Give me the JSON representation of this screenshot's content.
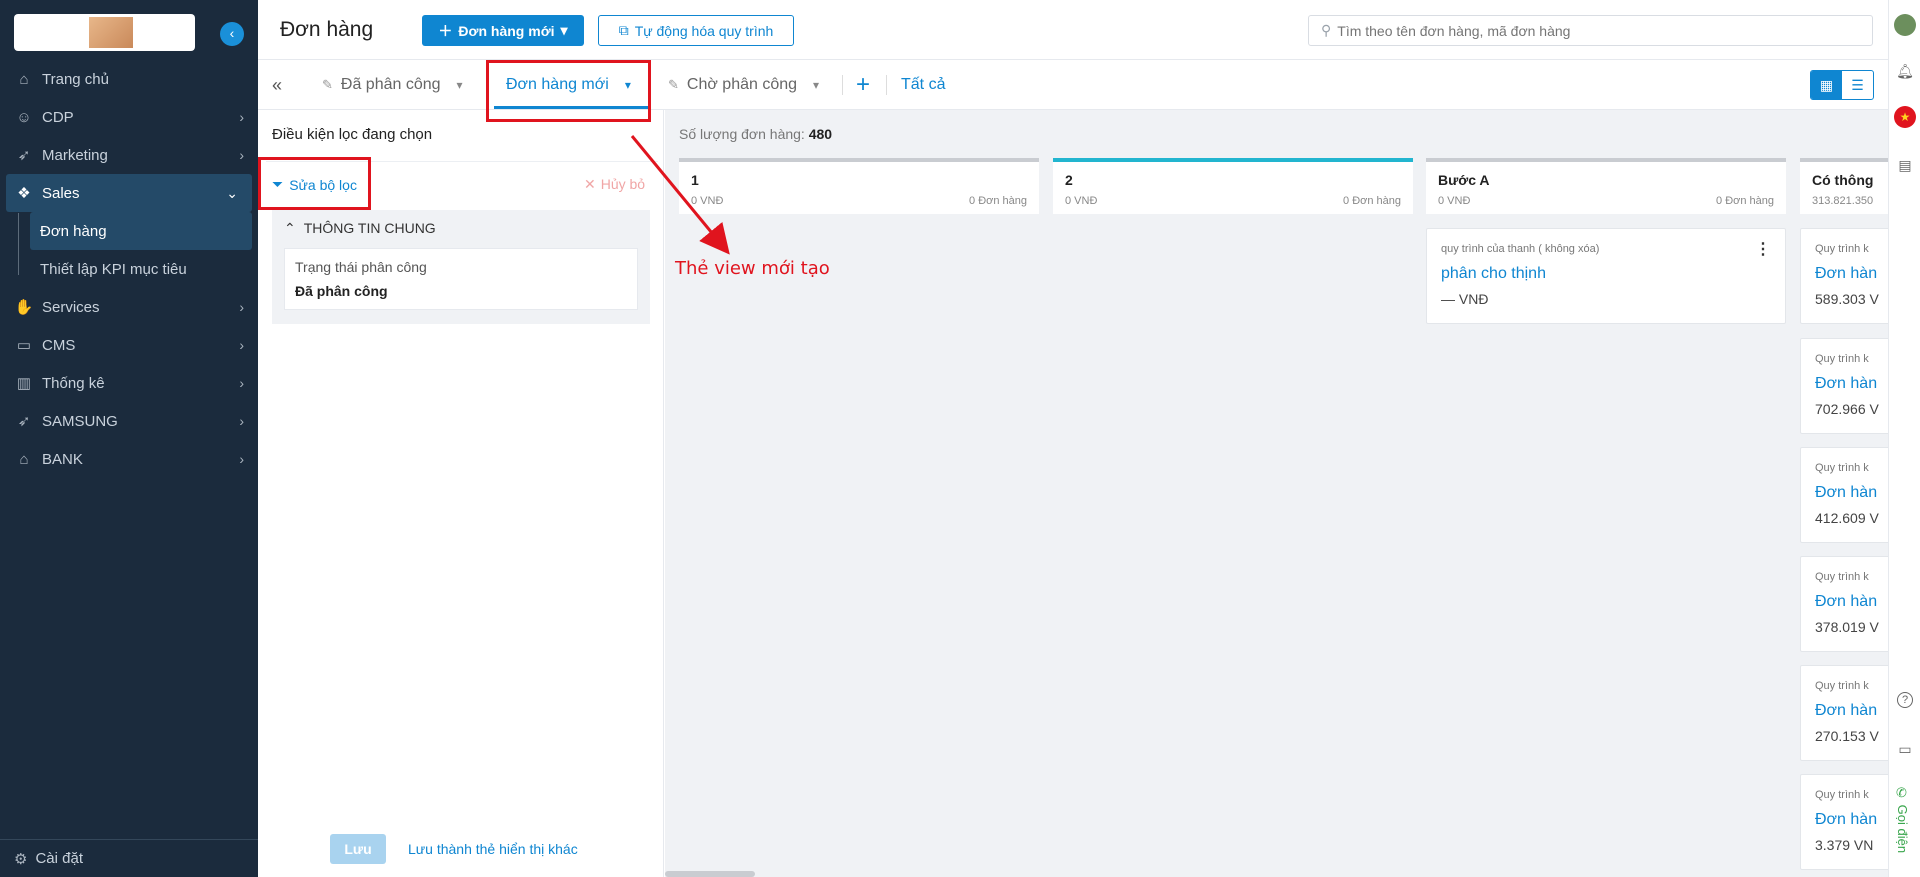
{
  "sidebar": {
    "items": [
      {
        "label": "Trang chủ",
        "icon": "home-icon"
      },
      {
        "label": "CDP",
        "icon": "user-icon"
      },
      {
        "label": "Marketing",
        "icon": "rocket-icon"
      },
      {
        "label": "Sales",
        "icon": "handshake-icon"
      },
      {
        "label": "Services",
        "icon": "hand-icon"
      },
      {
        "label": "CMS",
        "icon": "monitor-icon"
      },
      {
        "label": "Thống kê",
        "icon": "chart-icon"
      },
      {
        "label": "SAMSUNG",
        "icon": "rocket-icon"
      },
      {
        "label": "BANK",
        "icon": "bank-icon"
      }
    ],
    "sub_items": [
      {
        "label": "Đơn hàng"
      },
      {
        "label": "Thiết lập KPI mục tiêu"
      }
    ],
    "settings_label": "Cài đặt"
  },
  "header": {
    "title": "Đơn hàng",
    "new_order_label": "Đơn hàng mới",
    "automation_label": "Tự động hóa quy trình",
    "search_placeholder": "Tìm theo tên đơn hàng, mã đơn hàng"
  },
  "tabs": {
    "items": [
      {
        "label": "Đã phân công"
      },
      {
        "label": "Đơn hàng mới"
      },
      {
        "label": "Chờ phân công"
      }
    ],
    "all_label": "Tất cả"
  },
  "filter": {
    "title": "Điều kiện lọc đang chọn",
    "edit_label": "Sửa bộ lọc",
    "cancel_label": "Hủy bỏ",
    "section_title": "THÔNG TIN CHUNG",
    "field_label": "Trạng thái phân công",
    "field_value": "Đã phân công",
    "save_label": "Lưu",
    "save_as_label": "Lưu thành thẻ hiển thị khác"
  },
  "board": {
    "count_label": "Số lượng đơn hàng:",
    "count_value": "480",
    "columns": [
      {
        "title": "1",
        "amount": "0 VNĐ",
        "count": "0 Đơn hàng"
      },
      {
        "title": "2",
        "amount": "0 VNĐ",
        "count": "0 Đơn hàng"
      },
      {
        "title": "Bước A",
        "amount": "0 VNĐ",
        "count": "0 Đơn hàng"
      },
      {
        "title": "Có thông",
        "amount": "313.821.350",
        "count": ""
      }
    ],
    "card_a": {
      "process": "quy trình của thanh ( không xóa)",
      "name": "phân cho thịnh",
      "value": "— VNĐ"
    },
    "partial_cards": [
      {
        "process": "Quy trình k",
        "name": "Đơn hàn",
        "value": "589.303 V"
      },
      {
        "process": "Quy trình k",
        "name": "Đơn hàn",
        "value": "702.966 V"
      },
      {
        "process": "Quy trình k",
        "name": "Đơn hàn",
        "value": "412.609 V"
      },
      {
        "process": "Quy trình k",
        "name": "Đơn hàn",
        "value": "378.019 V"
      },
      {
        "process": "Quy trình k",
        "name": "Đơn hàn",
        "value": "270.153 V"
      },
      {
        "process": "Quy trình k",
        "name": "Đơn hàn",
        "value": "3.379 VN"
      }
    ]
  },
  "annotation": {
    "text": "Thẻ view mới tạo",
    "color": "#e0141e"
  },
  "rail": {
    "call_label": "Gọi điện"
  },
  "colors": {
    "sidebar_bg": "#1b2b3d",
    "accent": "#0f86d1",
    "teal": "#22b5cf"
  }
}
